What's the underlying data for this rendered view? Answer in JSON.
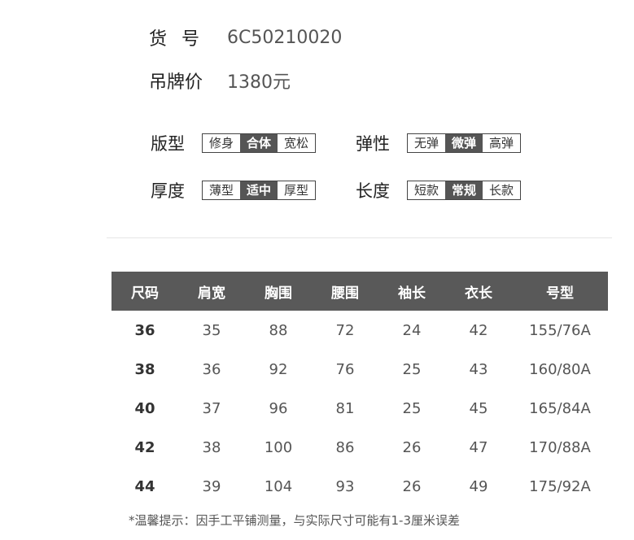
{
  "product": {
    "sku_label": "货号",
    "sku_value": "6C50210020",
    "price_label": "吊牌价",
    "price_value": "1380元"
  },
  "attributes": {
    "fit": {
      "label": "版型",
      "options": [
        "修身",
        "合体",
        "宽松"
      ],
      "selected": "合体"
    },
    "stretch": {
      "label": "弹性",
      "options": [
        "无弹",
        "微弹",
        "高弹"
      ],
      "selected": "微弹"
    },
    "thickness": {
      "label": "厚度",
      "options": [
        "薄型",
        "适中",
        "厚型"
      ],
      "selected": "适中"
    },
    "length": {
      "label": "长度",
      "options": [
        "短款",
        "常规",
        "长款"
      ],
      "selected": "常规"
    }
  },
  "size_table": {
    "headers": [
      "尺码",
      "肩宽",
      "胸围",
      "腰围",
      "袖长",
      "衣长",
      "号型"
    ],
    "rows": [
      [
        "36",
        "35",
        "88",
        "72",
        "24",
        "42",
        "155/76A"
      ],
      [
        "38",
        "36",
        "92",
        "76",
        "25",
        "43",
        "160/80A"
      ],
      [
        "40",
        "37",
        "96",
        "81",
        "25",
        "45",
        "165/84A"
      ],
      [
        "42",
        "38",
        "100",
        "86",
        "26",
        "47",
        "170/88A"
      ],
      [
        "44",
        "39",
        "104",
        "93",
        "26",
        "49",
        "175/92A"
      ]
    ]
  },
  "note": "*温馨提示：因手工平铺测量，与实际尺寸可能有1-3厘米误差",
  "colors": {
    "header_bg": "#595959",
    "selected_bg": "#555555",
    "border": "#444444"
  }
}
